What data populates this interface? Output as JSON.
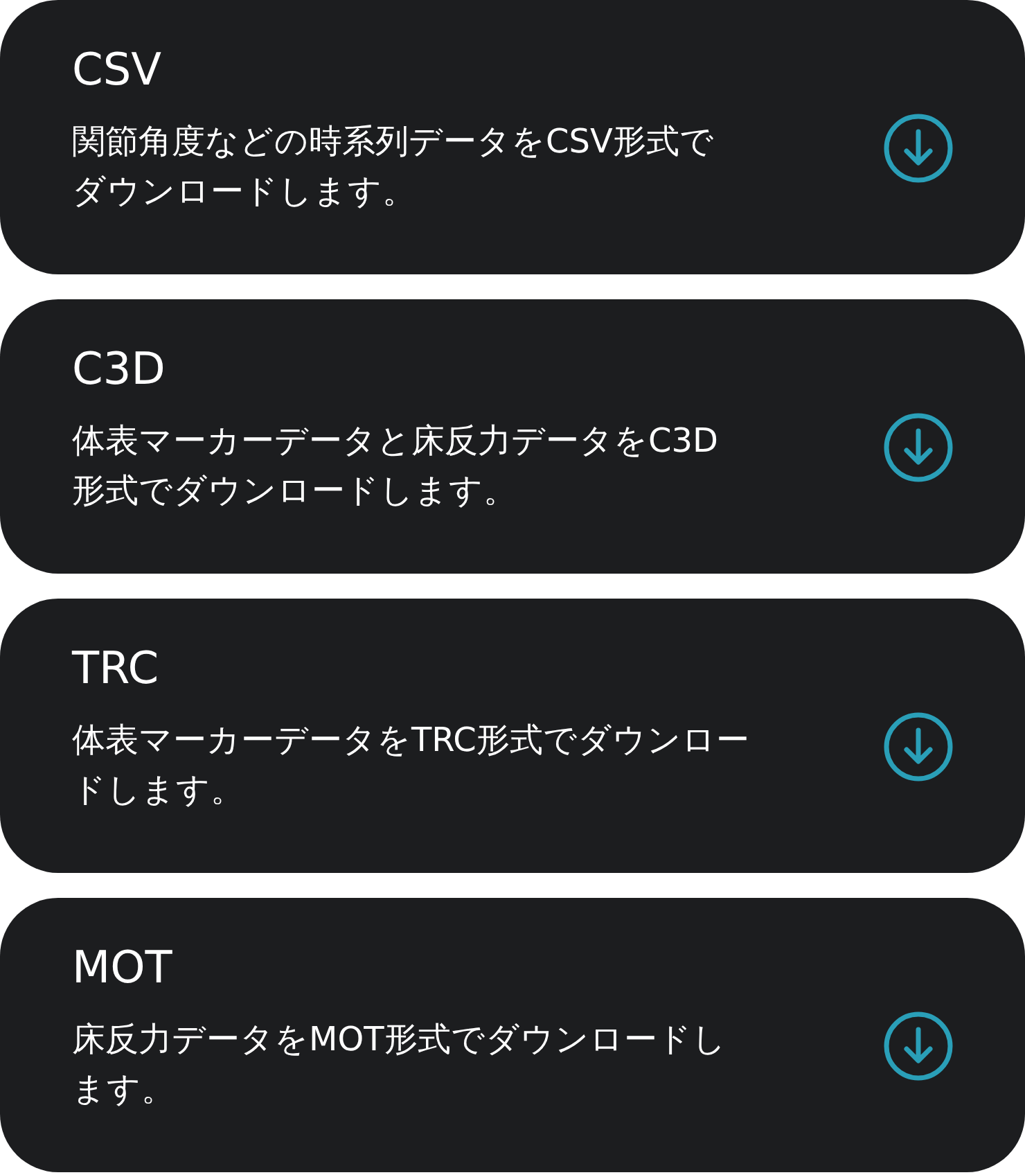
{
  "downloads": [
    {
      "title": "CSV",
      "description_lines": [
        "関節角度などの時系列データをCSV形式で",
        "ダウンロードします。"
      ]
    },
    {
      "title": "C3D",
      "description_lines": [
        "体表マーカーデータと床反力データをC3D",
        "形式でダウンロードします。"
      ]
    },
    {
      "title": "TRC",
      "description_lines": [
        "体表マーカーデータをTRC形式でダウンロー",
        "ドします。"
      ]
    },
    {
      "title": "MOT",
      "description_lines": [
        "床反力データをMOT形式でダウンロードし",
        "ます。"
      ]
    }
  ]
}
